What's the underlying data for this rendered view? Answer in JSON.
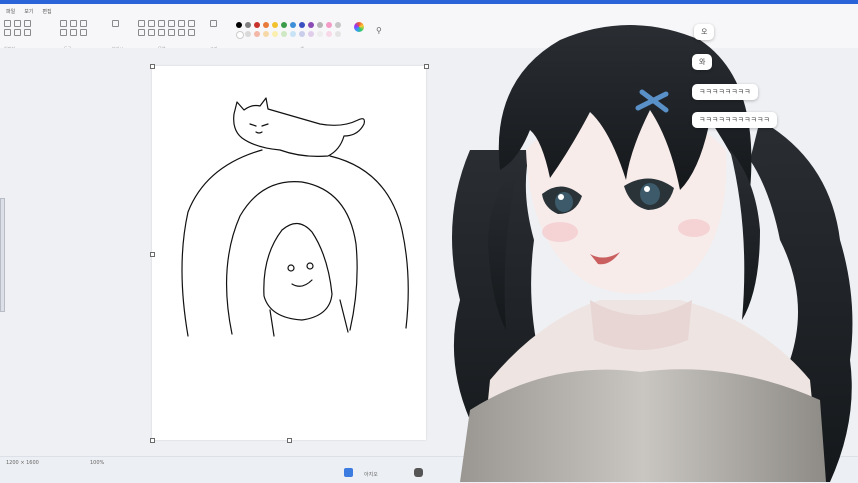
{
  "app": {
    "tabs": [
      "파일",
      "보기",
      "편집"
    ],
    "status": {
      "left": "1200 × 1600",
      "mid": "100%",
      "center": "아지오"
    }
  },
  "ribbon": {
    "groups": [
      "이미지",
      "도구",
      "브러시",
      "모양",
      "크기",
      "색"
    ],
    "palette_colors": [
      "#000000",
      "#7f7f7f",
      "#c8312b",
      "#e87a3b",
      "#f2c12e",
      "#3a9b4a",
      "#3d8fd8",
      "#3c4fc1",
      "#8a4bb5",
      "#b5b5b5",
      "#f39ac7",
      "#c6c6c6",
      "#ffffff",
      "#d9d9d9",
      "#f2b7a6",
      "#f7d9a8",
      "#fbefb0",
      "#cfe8c4",
      "#c8e2f6",
      "#c9cdeb",
      "#e0cdea",
      "#ededed",
      "#f7d8e6",
      "#e4e4e4"
    ]
  },
  "chat": {
    "messages": [
      "오",
      "와",
      "ㅋㅋㅋㅋㅋㅋㅋㅋ",
      "ㅋㅋㅋㅋㅋㅋㅋㅋㅋㅋㅋ"
    ]
  },
  "colors": {
    "accent": "#2b63d9",
    "hair": "#1f2226",
    "ribbon_bg": "#f7f7f9",
    "canvas_bg": "#ffffff"
  }
}
